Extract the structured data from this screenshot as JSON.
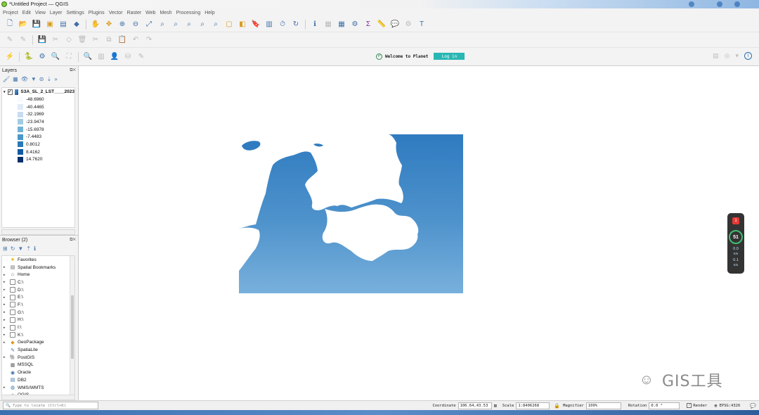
{
  "window": {
    "title": "*Untitled Project — QGIS"
  },
  "menu": [
    "Project",
    "Edit",
    "View",
    "Layer",
    "Settings",
    "Plugins",
    "Vector",
    "Raster",
    "Web",
    "Mesh",
    "Processing",
    "Help"
  ],
  "planet": {
    "welcome": "Welcome to Planet",
    "login": "Log in"
  },
  "layers_panel": {
    "title": "Layers",
    "layer": {
      "name": "S3A_SL_2_LST____2023",
      "checked": true
    },
    "legend": [
      {
        "label": "-48.6960",
        "color": "#f7fbff"
      },
      {
        "label": "-40.4465",
        "color": "#dfebf7"
      },
      {
        "label": "-32.1969",
        "color": "#c8dcf0"
      },
      {
        "label": "-23.9474",
        "color": "#a3cce3"
      },
      {
        "label": "-15.6978",
        "color": "#73b2d8"
      },
      {
        "label": "-7.4483",
        "color": "#4a97c9"
      },
      {
        "label": "0.8012",
        "color": "#2979b9"
      },
      {
        "label": "8.4162",
        "color": "#0f5aa3"
      },
      {
        "label": "14.7620",
        "color": "#08306b"
      }
    ]
  },
  "browser_panel": {
    "title": "Browser (2)",
    "items": [
      {
        "label": "Favorites",
        "icon": "star-icon",
        "arrow": false
      },
      {
        "label": "Spatial Bookmarks",
        "icon": "bookmark-icon",
        "arrow": true
      },
      {
        "label": "Home",
        "icon": "home-icon",
        "arrow": true
      },
      {
        "label": "C:\\",
        "icon": "folder-icon",
        "arrow": true
      },
      {
        "label": "D:\\",
        "icon": "folder-icon",
        "arrow": true
      },
      {
        "label": "E:\\",
        "icon": "folder-icon",
        "arrow": true
      },
      {
        "label": "F:\\",
        "icon": "folder-icon",
        "arrow": true
      },
      {
        "label": "G:\\",
        "icon": "folder-icon",
        "arrow": true
      },
      {
        "label": "H:\\",
        "icon": "folder-icon",
        "arrow": true
      },
      {
        "label": "I:\\",
        "icon": "folder-icon",
        "arrow": true
      },
      {
        "label": "K:\\",
        "icon": "folder-icon",
        "arrow": true
      },
      {
        "label": "GeoPackage",
        "icon": "geopackage-icon",
        "arrow": true
      },
      {
        "label": "SpatiaLite",
        "icon": "spatialite-icon",
        "arrow": false
      },
      {
        "label": "PostGIS",
        "icon": "postgis-icon",
        "arrow": true
      },
      {
        "label": "MSSQL",
        "icon": "mssql-icon",
        "arrow": false
      },
      {
        "label": "Oracle",
        "icon": "oracle-icon",
        "arrow": false
      },
      {
        "label": "DB2",
        "icon": "db2-icon",
        "arrow": false
      },
      {
        "label": "WMS/WMTS",
        "icon": "wms-icon",
        "arrow": true
      },
      {
        "label": "QGIS",
        "icon": "qgis-icon",
        "arrow": false
      }
    ]
  },
  "perf_widget": {
    "badge": "1",
    "cpu": "51",
    "up": "0.0",
    "up_unit": "K/s",
    "down": "0.1",
    "down_unit": "K/s"
  },
  "watermark": {
    "text": "GIS工具"
  },
  "status": {
    "locate_placeholder": "Type to locate (Ctrl+K)",
    "coordinate_label": "Coordinate",
    "coordinate": "106.64,43.53",
    "scale_label": "Scale",
    "scale": "1:8406268",
    "magnifier_label": "Magnifier",
    "magnifier": "100%",
    "rotation_label": "Rotation",
    "rotation": "0.0 °",
    "render_label": "Render",
    "crs": "EPSG:4326"
  }
}
